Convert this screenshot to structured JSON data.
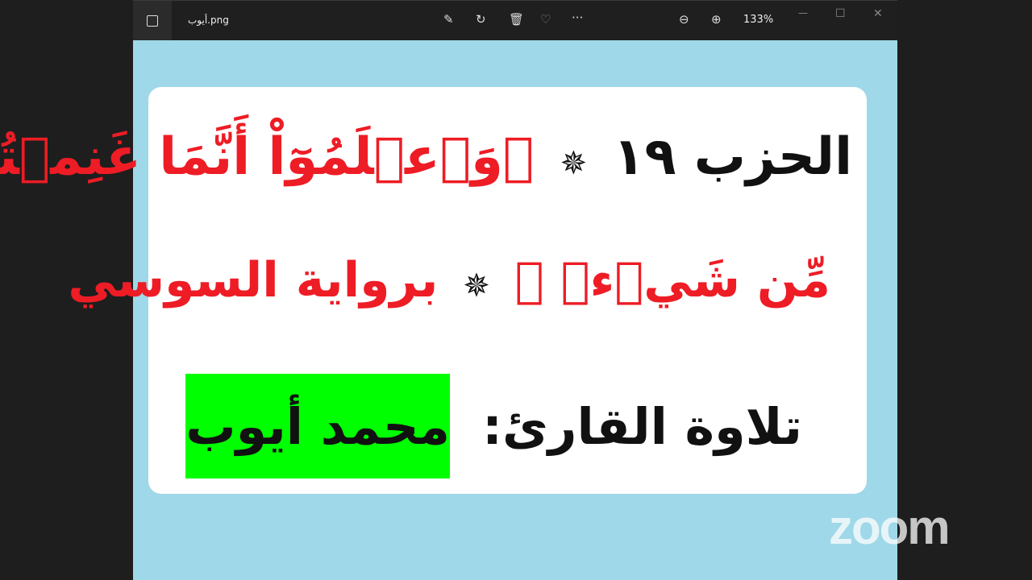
{
  "window": {
    "file_name": "أيوب.png",
    "zoom_level": "133%"
  },
  "toolbar": {
    "icons": [
      "image-icon",
      "edit-icon",
      "rotate-icon",
      "delete-icon",
      "favorite-icon",
      "more-icon",
      "zoom-out-icon",
      "zoom-in-icon",
      "minimize-icon",
      "maximize-icon",
      "close-icon"
    ],
    "more": "···",
    "minimize": "—",
    "maximize": "☐",
    "close": "✕"
  },
  "image": {
    "hizb": "الحزب ١٩",
    "verse_start": "﴿وَٱعۡلَمُوٓاْ أَنَّمَا غَنِمۡتُم",
    "verse_end": "مِّن شَيۡءٖ ﴾",
    "riwaya": "برواية السوسي",
    "reciter_label": "تلاوة القارئ:",
    "reciter_name": "محمد أيوب",
    "colors": {
      "background": "#9fd8e8",
      "verse": "#ee1c25",
      "highlight": "#00ff00"
    }
  },
  "watermark": "zoom"
}
